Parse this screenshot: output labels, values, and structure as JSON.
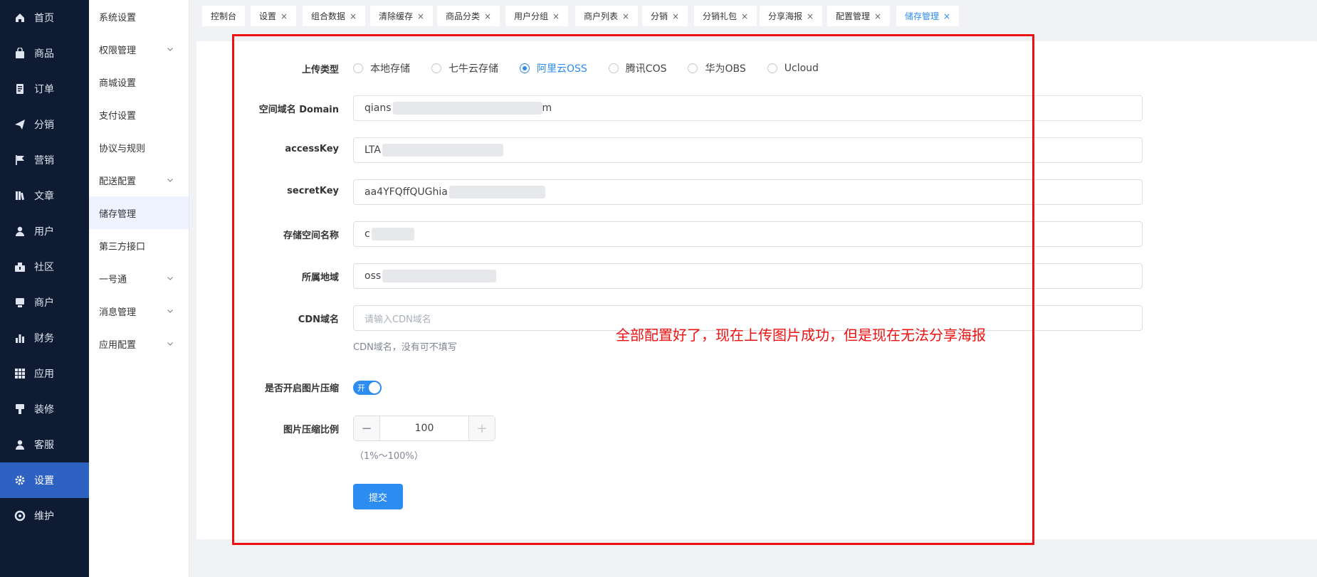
{
  "sidebar": {
    "items": [
      {
        "label": "首页",
        "icon": "home-icon"
      },
      {
        "label": "商品",
        "icon": "bag-icon"
      },
      {
        "label": "订单",
        "icon": "order-icon"
      },
      {
        "label": "分销",
        "icon": "send-icon"
      },
      {
        "label": "营销",
        "icon": "flag-icon"
      },
      {
        "label": "文章",
        "icon": "article-icon"
      },
      {
        "label": "用户",
        "icon": "user-icon"
      },
      {
        "label": "社区",
        "icon": "community-icon"
      },
      {
        "label": "商户",
        "icon": "merchant-icon"
      },
      {
        "label": "财务",
        "icon": "chart-icon"
      },
      {
        "label": "应用",
        "icon": "grid-icon"
      },
      {
        "label": "装修",
        "icon": "brush-icon"
      },
      {
        "label": "客服",
        "icon": "service-icon"
      },
      {
        "label": "设置",
        "icon": "gear-icon"
      },
      {
        "label": "维护",
        "icon": "maintenance-icon"
      }
    ],
    "active_index": 13
  },
  "submenu": {
    "items": [
      {
        "label": "系统设置",
        "expandable": false
      },
      {
        "label": "权限管理",
        "expandable": true
      },
      {
        "label": "商城设置",
        "expandable": false
      },
      {
        "label": "支付设置",
        "expandable": false
      },
      {
        "label": "协议与规则",
        "expandable": false
      },
      {
        "label": "配送配置",
        "expandable": true
      },
      {
        "label": "储存管理",
        "expandable": false
      },
      {
        "label": "第三方接口",
        "expandable": false
      },
      {
        "label": "一号通",
        "expandable": true
      },
      {
        "label": "消息管理",
        "expandable": true
      },
      {
        "label": "应用配置",
        "expandable": true
      }
    ],
    "active_index": 6
  },
  "tabs": [
    {
      "label": "控制台",
      "closable": false
    },
    {
      "label": "设置",
      "closable": true
    },
    {
      "label": "组合数据",
      "closable": true
    },
    {
      "label": "清除缓存",
      "closable": true
    },
    {
      "label": "商品分类",
      "closable": true
    },
    {
      "label": "用户分组",
      "closable": true
    },
    {
      "label": "商户列表",
      "closable": true
    },
    {
      "label": "分销",
      "closable": true
    },
    {
      "label": "分销礼包",
      "closable": true
    },
    {
      "label": "分享海报",
      "closable": true
    },
    {
      "label": "配置管理",
      "closable": true
    },
    {
      "label": "储存管理",
      "closable": true
    }
  ],
  "active_tab": 11,
  "form": {
    "upload_type_label": "上传类型",
    "upload_options": [
      "本地存储",
      "七牛云存储",
      "阿里云OSS",
      "腾讯COS",
      "华为OBS",
      "Ucloud"
    ],
    "upload_selected": "阿里云OSS",
    "domain_label": "空间域名 Domain",
    "domain_value_prefix": "qians",
    "domain_value_suffix": "m",
    "accesskey_label": "accessKey",
    "accesskey_value_prefix": "LTA",
    "secretkey_label": "secretKey",
    "secretkey_value_prefix": "aa4YFQffQUGhia",
    "bucket_label": "存储空间名称",
    "bucket_value_prefix": "c",
    "region_label": "所属地域",
    "region_value_prefix": "oss",
    "cdn_label": "CDN域名",
    "cdn_placeholder": "请输入CDN域名",
    "cdn_hint": "CDN域名，没有可不填写",
    "compress_label": "是否开启图片压缩",
    "compress_toggle_text": "开",
    "compress_on": true,
    "ratio_label": "图片压缩比例",
    "ratio_value": "100",
    "ratio_hint": "（1%～100%）",
    "submit_label": "提交"
  },
  "annotation": {
    "text": "全部配置好了，现在上传图片成功，但是现在无法分享海报",
    "color": "#ee1111"
  }
}
